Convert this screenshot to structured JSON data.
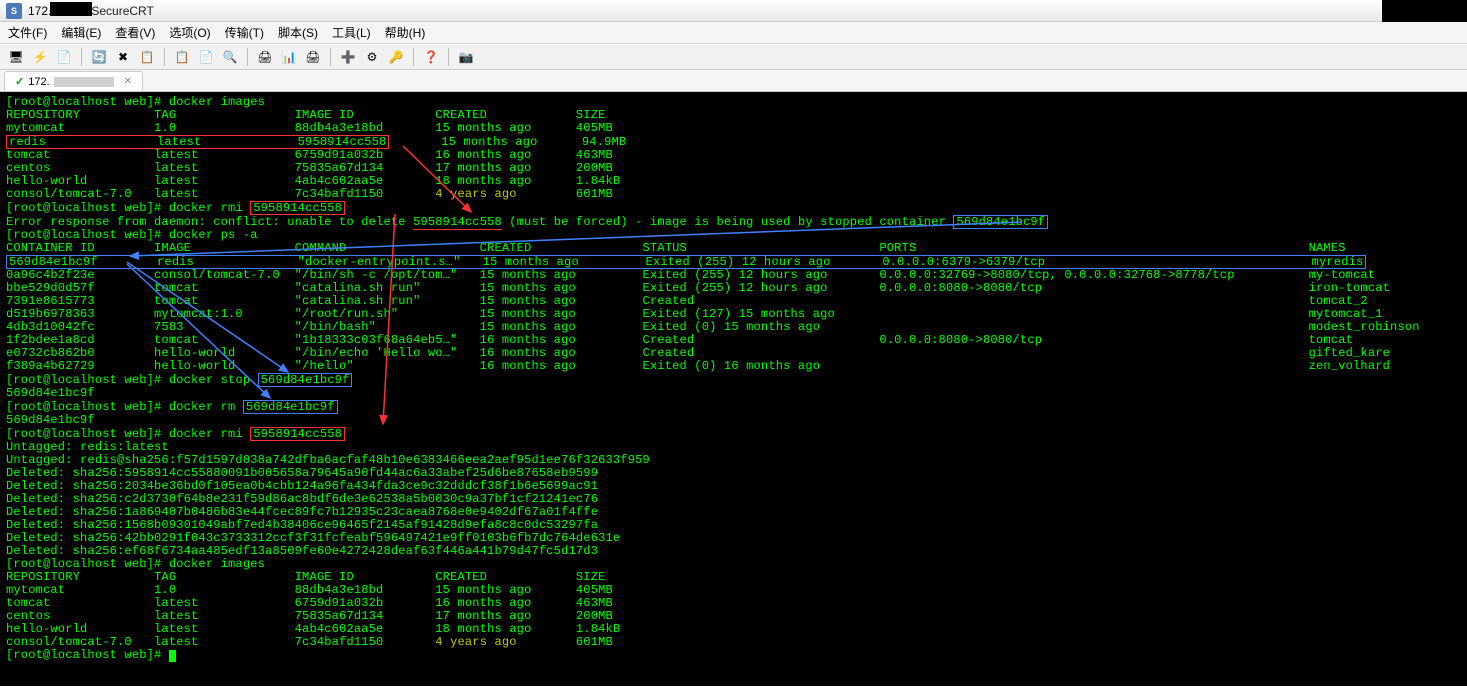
{
  "title": {
    "ip": "172.",
    "app": "SecureCRT"
  },
  "menu": {
    "file": "文件(F)",
    "edit": "编辑(E)",
    "view": "查看(V)",
    "options": "选项(O)",
    "transfer": "传输(T)",
    "script": "脚本(S)",
    "tools": "工具(L)",
    "help": "帮助(H)"
  },
  "tab": {
    "label": "172.",
    "close": "✕"
  },
  "prompt": "[root@localhost web]#",
  "cmd": {
    "images": "docker images",
    "rmi1": "docker rmi",
    "rmi1_arg": "5958914cc558",
    "ps": "docker ps -a",
    "stop": "docker stop",
    "stop_arg": "569d84e1bc9f",
    "rm": "docker rm",
    "rm_arg": "569d84e1bc9f",
    "rmi2": "docker rmi",
    "rmi2_arg": "5958914cc558"
  },
  "image_header": {
    "repo": "REPOSITORY",
    "tag": "TAG",
    "id": "IMAGE ID",
    "created": "CREATED",
    "size": "SIZE"
  },
  "images1": [
    {
      "repo": "mytomcat",
      "tag": "1.0",
      "id": "88db4a3e18bd",
      "created": "15 months ago",
      "size": "405MB"
    },
    {
      "repo": "redis",
      "tag": "latest",
      "id": "5958914cc558",
      "created": "15 months ago",
      "size": "94.9MB",
      "redbox": true
    },
    {
      "repo": "tomcat",
      "tag": "latest",
      "id": "6759d91a032b",
      "created": "16 months ago",
      "size": "463MB"
    },
    {
      "repo": "centos",
      "tag": "latest",
      "id": "75835a67d134",
      "created": "17 months ago",
      "size": "200MB"
    },
    {
      "repo": "hello-world",
      "tag": "latest",
      "id": "4ab4c602aa5e",
      "created": "18 months ago",
      "size": "1.84kB"
    },
    {
      "repo": "consol/tomcat-7.0",
      "tag": "latest",
      "id": "7c34bafd1150",
      "created": "4 years ago",
      "size": "601MB",
      "yellowcreated": true
    }
  ],
  "error": {
    "pre": "Error response from daemon: conflict: unable to delete ",
    "id": "5958914cc558",
    "mid": " (must be forced) - image is being used by stopped container ",
    "cid": "569d84e1bc9f"
  },
  "ps_header": {
    "cid": "CONTAINER ID",
    "image": "IMAGE",
    "command": "COMMAND",
    "created": "CREATED",
    "status": "STATUS",
    "ports": "PORTS",
    "names": "NAMES"
  },
  "containers": [
    {
      "cid": "569d84e1bc9f",
      "image": "redis",
      "command": "\"docker-entrypoint.s…\"",
      "created": "15 months ago",
      "status": "Exited (255) 12 hours ago",
      "ports": "0.0.0.0:6379->6379/tcp",
      "names": "myredis",
      "bluebox": true
    },
    {
      "cid": "0a96c4b2f23e",
      "image": "consol/tomcat-7.0",
      "command": "\"/bin/sh -c /opt/tom…\"",
      "created": "15 months ago",
      "status": "Exited (255) 12 hours ago",
      "ports": "0.0.0.0:32769->8080/tcp, 0.0.0.0:32768->8778/tcp",
      "names": "my-tomcat"
    },
    {
      "cid": "bbe529d0d57f",
      "image": "tomcat",
      "command": "\"catalina.sh run\"",
      "created": "15 months ago",
      "status": "Exited (255) 12 hours ago",
      "ports": "0.0.0.0:8080->8080/tcp",
      "names": "iron-tomcat"
    },
    {
      "cid": "7391e8615773",
      "image": "tomcat",
      "command": "\"catalina.sh run\"",
      "created": "15 months ago",
      "status": "Created",
      "ports": "",
      "names": "tomcat_2"
    },
    {
      "cid": "d519b6978363",
      "image": "mytomcat:1.0",
      "command": "\"/root/run.sh\"",
      "created": "15 months ago",
      "status": "Exited (127) 15 months ago",
      "ports": "",
      "names": "mytomcat_1"
    },
    {
      "cid": "4db3d10042fc",
      "image": "7583",
      "command": "\"/bin/bash\"",
      "created": "15 months ago",
      "status": "Exited (0) 15 months ago",
      "ports": "",
      "names": "modest_robinson"
    },
    {
      "cid": "1f2bdee1a8cd",
      "image": "tomcat",
      "command": "\"1b18333c03f68a64eb5…\"",
      "created": "16 months ago",
      "status": "Created",
      "ports": "0.0.0.0:8080->8080/tcp",
      "names": "tomcat"
    },
    {
      "cid": "e0732cb862b0",
      "image": "hello-world",
      "command": "\"/bin/echo 'Hello wo…\"",
      "created": "16 months ago",
      "status": "Created",
      "ports": "",
      "names": "gifted_kare"
    },
    {
      "cid": "f389a4b62729",
      "image": "hello-world",
      "command": "\"/hello\"",
      "created": "16 months ago",
      "status": "Exited (0) 16 months ago",
      "ports": "",
      "names": "zen_volhard"
    }
  ],
  "stop_out": "569d84e1bc9f",
  "rm_out": "569d84e1bc9f",
  "untag1": "Untagged: redis:latest",
  "untag2": "Untagged: redis@sha256:f57d1597d038a742dfba6acfaf48b10e6383466eea2aef95d1ee76f32633f959",
  "deleted": [
    "Deleted: sha256:5958914cc55880091b005658a79645a90fd44ac6a33abef25d6be87658eb9599",
    "Deleted: sha256:2034be36bd0f105ea0b4cbb124a96fa434fda3ce9c32dddcf38f1b6e5699ac91",
    "Deleted: sha256:c2d3730f64b8e231f59d86ac8bdf6de3e62538a5b0030c9a37bf1cf21241ec76",
    "Deleted: sha256:1a869407b0486b83e44fcec89fc7b12935c23caea8768e0e9402df67a01f4ffe",
    "Deleted: sha256:1568b09301049abf7ed4b38406ce96465f2145af91428d9efa8c8c0dc53297fa",
    "Deleted: sha256:42bb0291f043c3733312ccf3f31fcfeabf596497421e9ff0103b6fb7dc764de631e",
    "Deleted: sha256:ef68f6734aa485edf13a8509fe60e4272428deaf63f446a441b79d47fc5d17d3"
  ],
  "images2": [
    {
      "repo": "mytomcat",
      "tag": "1.0",
      "id": "88db4a3e18bd",
      "created": "15 months ago",
      "size": "405MB"
    },
    {
      "repo": "tomcat",
      "tag": "latest",
      "id": "6759d91a032b",
      "created": "16 months ago",
      "size": "463MB"
    },
    {
      "repo": "centos",
      "tag": "latest",
      "id": "75835a67d134",
      "created": "17 months ago",
      "size": "200MB"
    },
    {
      "repo": "hello-world",
      "tag": "latest",
      "id": "4ab4c602aa5e",
      "created": "18 months ago",
      "size": "1.84kB"
    },
    {
      "repo": "consol/tomcat-7.0",
      "tag": "latest",
      "id": "7c34bafd1150",
      "created": "4 years ago",
      "size": "601MB",
      "yellowcreated": true
    }
  ]
}
